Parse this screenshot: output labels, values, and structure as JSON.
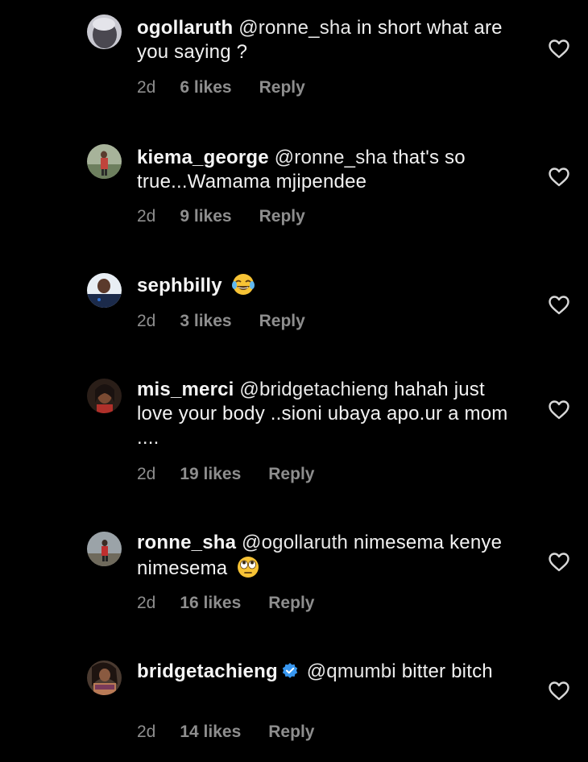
{
  "comments": [
    {
      "username": "ogollaruth",
      "mention": "@ronne_sha",
      "text": " in short what are you saying ?",
      "time": "2d",
      "likes": "6 likes",
      "reply": "Reply",
      "avatar_color": "#5a5a62"
    },
    {
      "username": "kiema_george",
      "mention": "@ronne_sha",
      "text": " that's so true...Wamama mjipendee",
      "time": "2d",
      "likes": "9 likes",
      "reply": "Reply",
      "avatar_color": "#6b7a64"
    },
    {
      "username": "sephbilly",
      "mention": "",
      "text": "",
      "emoji": "face-with-tears-of-joy",
      "time": "2d",
      "likes": "3 likes",
      "reply": "Reply",
      "avatar_color": "#8fa7c4"
    },
    {
      "username": "mis_merci",
      "mention": "@bridgetachieng",
      "text": " hahah just love your body ..sioni ubaya apo.ur a mom ....",
      "time": "2d",
      "likes": "19 likes",
      "reply": "Reply",
      "avatar_color": "#3a2a22"
    },
    {
      "username": "ronne_sha",
      "mention": "@ogollaruth",
      "text": " nimesema kenye nimesema",
      "emoji": "face-with-rolling-eyes",
      "time": "2d",
      "likes": "16 likes",
      "reply": "Reply",
      "avatar_color": "#7c6a5e"
    },
    {
      "username": "bridgetachieng",
      "verified": true,
      "mention": "@qmumbi",
      "text": " bitter bitch",
      "time": "2d",
      "likes": "14 likes",
      "reply": "Reply",
      "avatar_color": "#9a6a50"
    }
  ],
  "colors": {
    "background": "#000000",
    "text": "#f2f2f2",
    "meta": "#8e8e8e",
    "verified": "#3897f0"
  },
  "icons": {
    "like": "heart-outline-icon",
    "verified": "verified-badge-icon"
  }
}
